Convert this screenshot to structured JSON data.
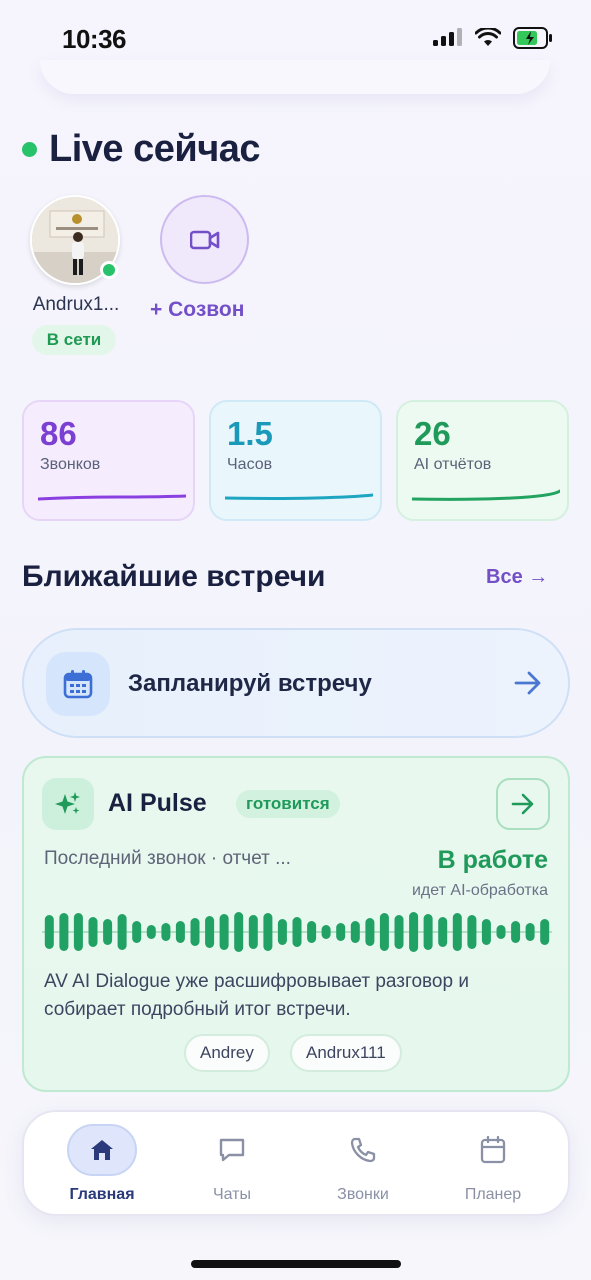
{
  "status_bar": {
    "time": "10:36"
  },
  "live": {
    "title": "Live сейчас"
  },
  "contact": {
    "name": "Andrux1...",
    "status": "В сети"
  },
  "call": {
    "label": "+ Созвон"
  },
  "stats": [
    {
      "value": "86",
      "label": "Звонков",
      "color": "#7b3fd2"
    },
    {
      "value": "1.5",
      "label": "Часов",
      "color": "#1a9ab8"
    },
    {
      "value": "26",
      "label": "AI отчётов",
      "color": "#1f9a5a"
    }
  ],
  "meetings": {
    "title": "Ближайшие встречи",
    "see_all": "Все →",
    "schedule_label": "Запланируй встречу"
  },
  "ai_pulse": {
    "title": "AI Pulse",
    "badge": "готовится",
    "last_call": "Последний звонок · отчет ...",
    "state": "В работе",
    "state_sub": "идет AI-обработка",
    "description": "AV AI Dialogue уже расшифровывает разговор и собирает подробный итог встречи.",
    "participants": [
      "Andrey",
      "Andrux111"
    ]
  },
  "tabbar": {
    "items": [
      {
        "label": "Главная",
        "icon": "home-icon",
        "active": true
      },
      {
        "label": "Чаты",
        "icon": "chat-icon",
        "active": false
      },
      {
        "label": "Звонки",
        "icon": "phone-icon",
        "active": false
      },
      {
        "label": "Планер",
        "icon": "calendar-icon",
        "active": false
      }
    ]
  }
}
